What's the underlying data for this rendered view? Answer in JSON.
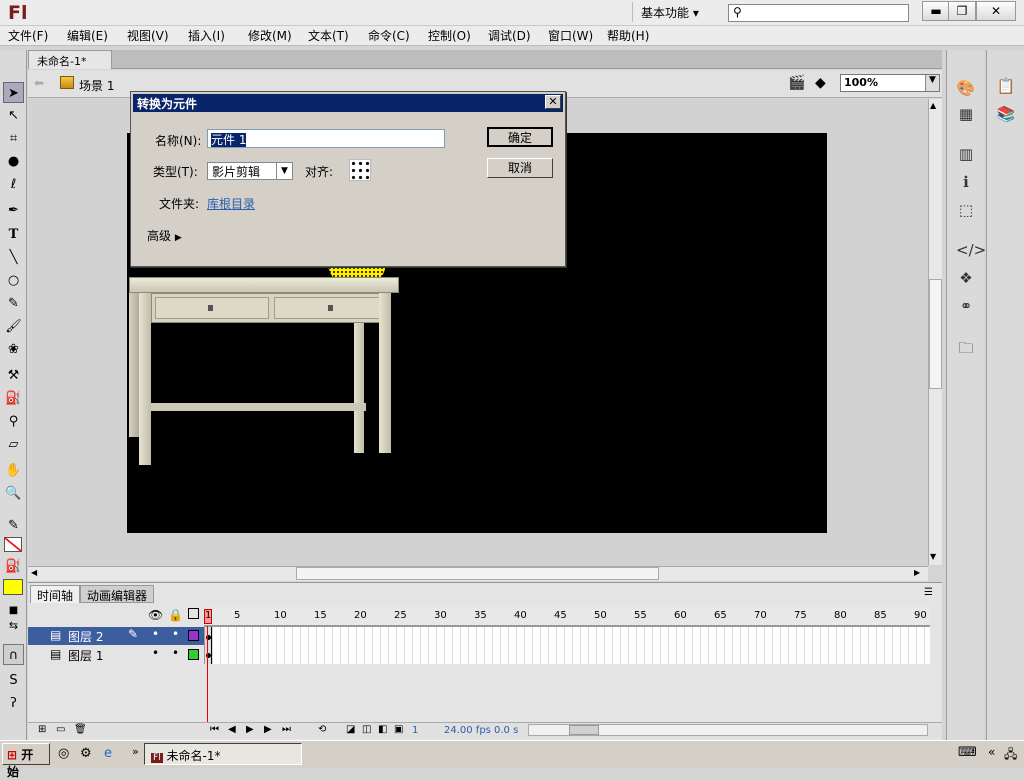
{
  "app": {
    "logo": "Fl",
    "workspace": "基本功能",
    "search_icon": "⚲"
  },
  "window_controls": {
    "min": "▬",
    "max": "❐",
    "close": "✕"
  },
  "menu": [
    "文件(F)",
    "编辑(E)",
    "视图(V)",
    "插入(I)",
    "修改(M)",
    "文本(T)",
    "命令(C)",
    "控制(O)",
    "调试(D)",
    "窗口(W)",
    "帮助(H)"
  ],
  "document": {
    "tab_title": "未命名-1*",
    "tab_close": "×",
    "scene": "场景 1",
    "zoom": "100%"
  },
  "dialog": {
    "title": "转换为元件",
    "close": "✕",
    "name_label": "名称(N):",
    "name_value": "元件 1",
    "type_label": "类型(T):",
    "type_value": "影片剪辑",
    "align_label": "对齐:",
    "folder_label": "文件夹:",
    "folder_value": "库根目录",
    "advanced_label": "高级",
    "ok_button": "确定",
    "cancel_button": "取消"
  },
  "timeline": {
    "tabs": [
      "时间轴",
      "动画编辑器"
    ],
    "layers": [
      {
        "name": "图层 2",
        "color": "#9933cc"
      },
      {
        "name": "图层 1",
        "color": "#33cc33"
      }
    ],
    "frame_numbers": [
      "1",
      "5",
      "10",
      "15",
      "20",
      "25",
      "30",
      "35",
      "40",
      "45",
      "50",
      "55",
      "60",
      "65",
      "70",
      "75",
      "80",
      "85",
      "90"
    ],
    "status": {
      "frame": "1",
      "fps": "24.00 fps",
      "time": "0.0 s"
    }
  },
  "taskbar": {
    "start": "开始",
    "task": "未命名-1*"
  },
  "colors": {
    "stroke": "#ff0000",
    "fill": "#ffff00",
    "dialog_title": "#0a246a"
  }
}
